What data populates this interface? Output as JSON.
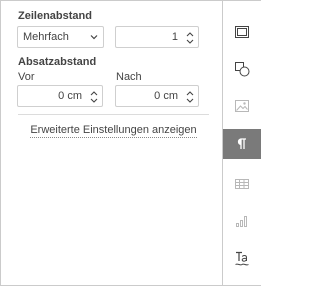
{
  "colors": {
    "text": "#444444",
    "border": "#cfcfcf",
    "active_tab": "#7a7a7a",
    "icon": "#444444",
    "icon_disabled": "#b8b8b8"
  },
  "line_spacing": {
    "title": "Zeilenabstand",
    "mode_value": "Mehrfach",
    "amount_value": "1"
  },
  "paragraph_spacing": {
    "title": "Absatzabstand",
    "before_label": "Vor",
    "before_value": "0 cm",
    "after_label": "Nach",
    "after_value": "0 cm"
  },
  "advanced_link": "Erweiterte Einstellungen anzeigen",
  "toolbar": {
    "items": [
      {
        "icon": "slide-icon",
        "active": false,
        "enabled": true
      },
      {
        "icon": "shape-icon",
        "active": false,
        "enabled": true
      },
      {
        "icon": "image-icon",
        "active": false,
        "enabled": false
      },
      {
        "icon": "paragraph-icon",
        "active": true,
        "enabled": true
      },
      {
        "icon": "table-icon",
        "active": false,
        "enabled": false
      },
      {
        "icon": "chart-icon",
        "active": false,
        "enabled": false
      },
      {
        "icon": "text-art-icon",
        "active": false,
        "enabled": true
      }
    ]
  }
}
